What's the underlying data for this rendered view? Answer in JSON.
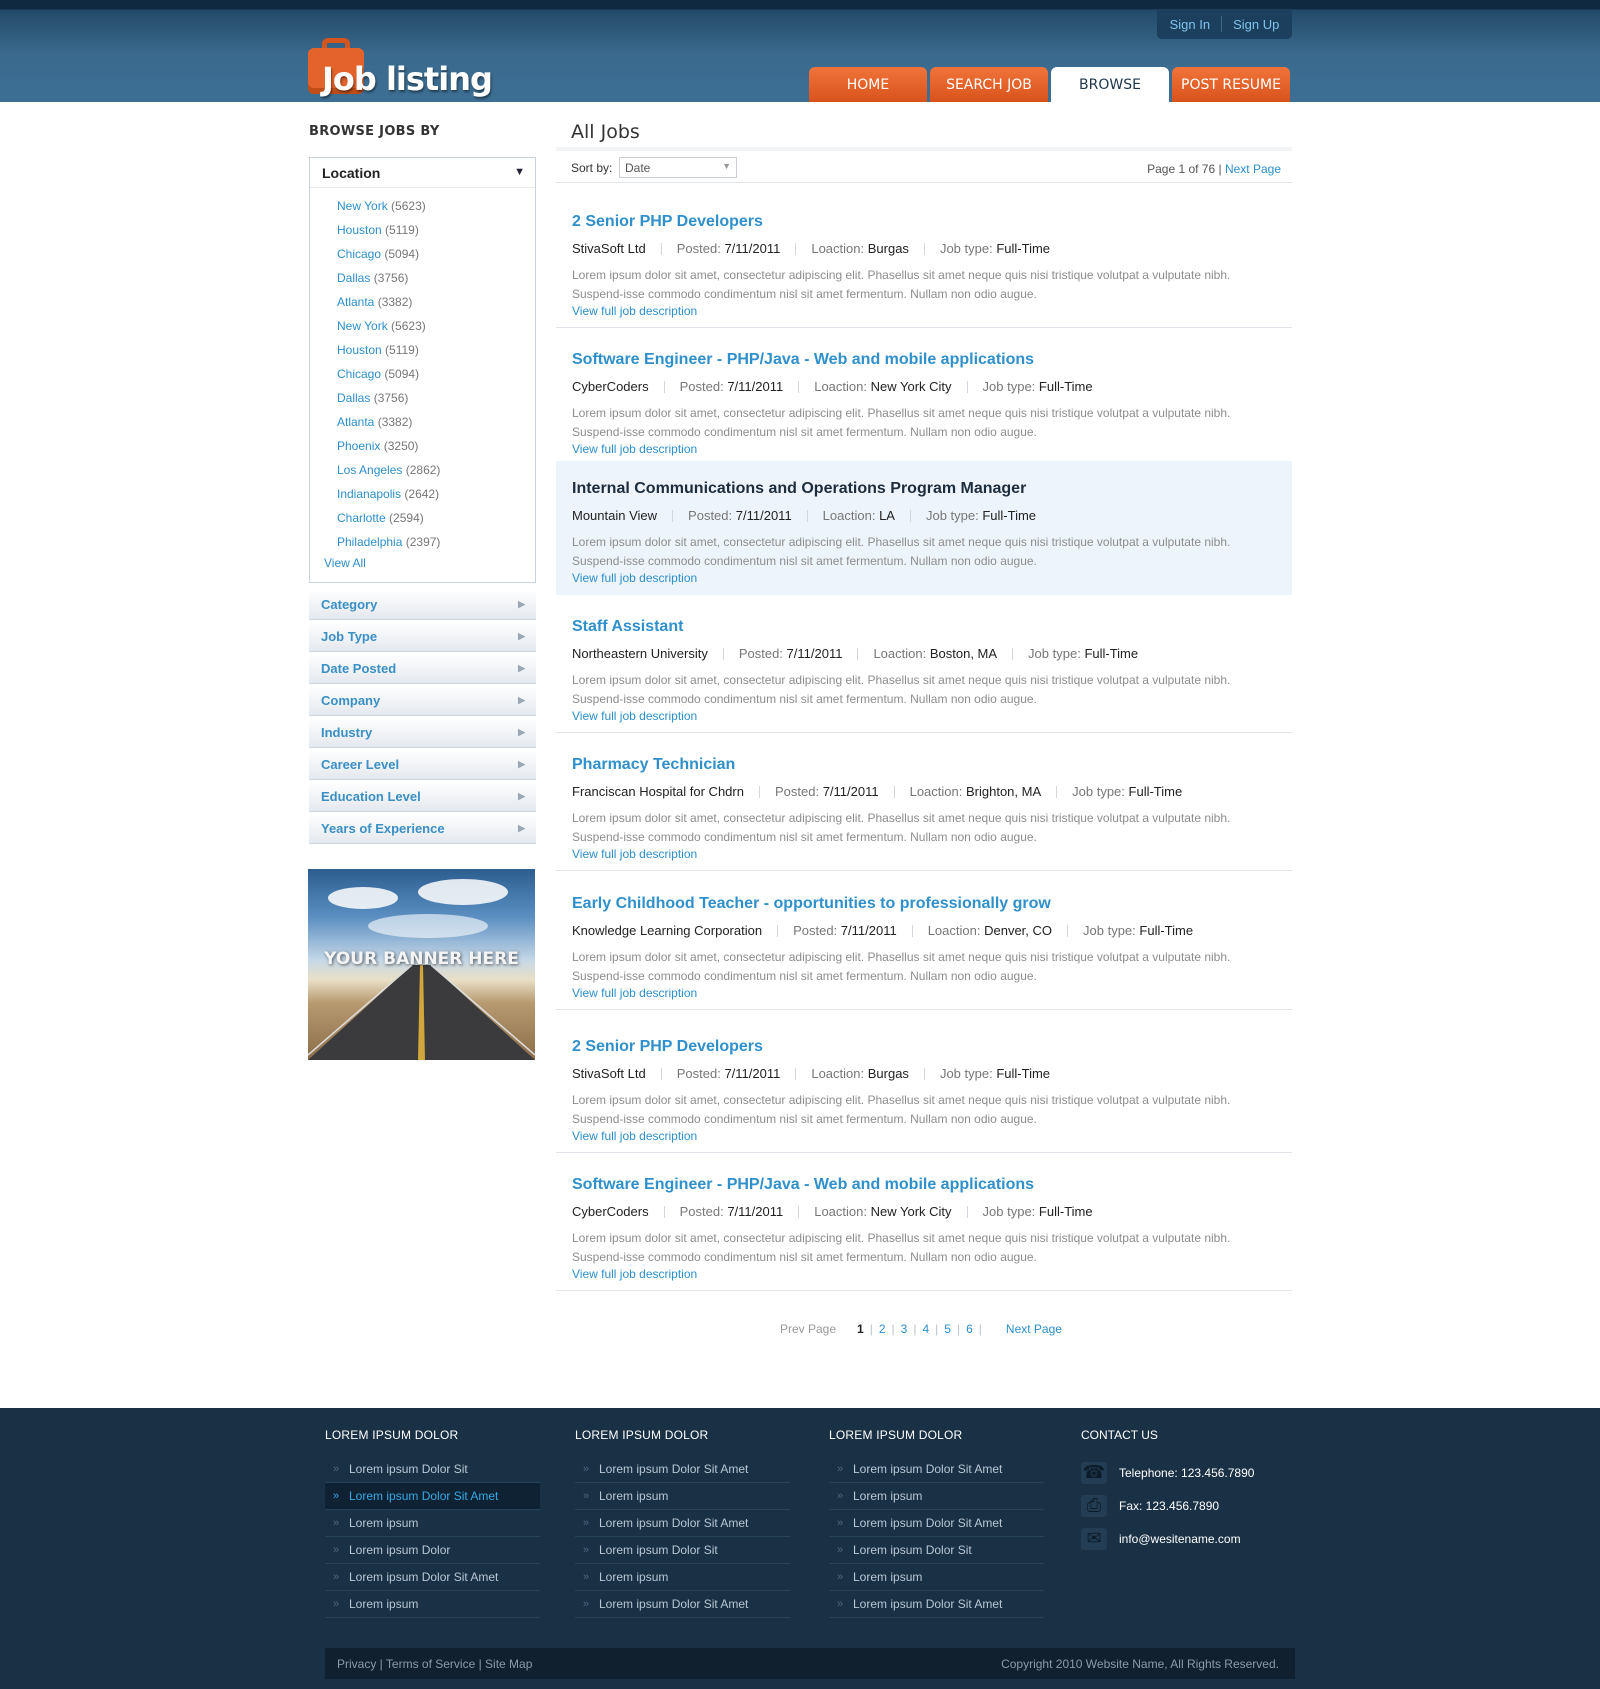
{
  "header": {
    "auth": {
      "sign_in": "Sign In",
      "sign_up": "Sign Up"
    },
    "logo": "Job listing",
    "nav": [
      {
        "label": "HOME",
        "active": false
      },
      {
        "label": "SEARCH JOB",
        "active": false
      },
      {
        "label": "BROWSE",
        "active": true
      },
      {
        "label": "POST RESUME",
        "active": false
      }
    ]
  },
  "sidebar": {
    "title": "BROWSE JOBS BY",
    "location": {
      "label": "Location",
      "items": [
        {
          "city": "New York",
          "count": "(5623)"
        },
        {
          "city": "Houston",
          "count": "(5119)"
        },
        {
          "city": "Chicago",
          "count": "(5094)"
        },
        {
          "city": "Dallas",
          "count": "(3756)"
        },
        {
          "city": "Atlanta",
          "count": "(3382)"
        },
        {
          "city": "New York",
          "count": "(5623)"
        },
        {
          "city": "Houston",
          "count": "(5119)"
        },
        {
          "city": "Chicago",
          "count": "(5094)"
        },
        {
          "city": "Dallas",
          "count": "(3756)"
        },
        {
          "city": "Atlanta",
          "count": "(3382)"
        },
        {
          "city": "Phoenix",
          "count": "(3250)"
        },
        {
          "city": "Los Angeles",
          "count": "(2862)"
        },
        {
          "city": "Indianapolis",
          "count": "(2642)"
        },
        {
          "city": "Charlotte",
          "count": "(2594)"
        },
        {
          "city": "Philadelphia",
          "count": "(2397)"
        }
      ],
      "view_all": "View All"
    },
    "filters": [
      "Category",
      "Job Type",
      "Date Posted",
      "Company",
      "Industry",
      "Career Level",
      "Education Level",
      "Years of Experience"
    ],
    "banner": "YOUR BANNER HERE"
  },
  "main": {
    "title": "All Jobs",
    "sort": {
      "label": "Sort by:",
      "value": "Date"
    },
    "page_info": "Page 1 of 76 |",
    "next_page": "Next Page",
    "jobs": [
      {
        "title": "2 Senior PHP Developers",
        "company": "StivaSoft Ltd",
        "posted_label": "Posted:",
        "posted": "7/11/2011",
        "location_label": "Loaction:",
        "location": "Burgas",
        "type_label": "Job type:",
        "type": "Full-Time",
        "desc": "Lorem ipsum dolor sit amet, consectetur adipiscing elit. Phasellus sit amet neque quis nisi tristique volutpat a vulputate nibh. Suspend-isse commodo condimentum nisl sit amet fermentum. Nullam non odio augue.",
        "more": "View full job description",
        "highlight": false
      },
      {
        "title": "Software Engineer - PHP/Java - Web and mobile applications",
        "company": "CyberCoders",
        "posted_label": "Posted:",
        "posted": "7/11/2011",
        "location_label": "Loaction:",
        "location": "New York City",
        "type_label": "Job type:",
        "type": "Full-Time",
        "desc": "Lorem ipsum dolor sit amet, consectetur adipiscing elit. Phasellus sit amet neque quis nisi tristique volutpat a vulputate nibh. Suspend-isse commodo condimentum nisl sit amet fermentum. Nullam non odio augue.",
        "more": "View full job description",
        "highlight": false
      },
      {
        "title": "Internal Communications and Operations Program Manager",
        "company": "Mountain View",
        "posted_label": "Posted:",
        "posted": "7/11/2011",
        "location_label": "Loaction:",
        "location": "LA",
        "type_label": "Job type:",
        "type": "Full-Time",
        "desc": "Lorem ipsum dolor sit amet, consectetur adipiscing elit. Phasellus sit amet neque quis nisi tristique volutpat a vulputate nibh. Suspend-isse commodo condimentum nisl sit amet fermentum. Nullam non odio augue.",
        "more": "View full job description",
        "highlight": true
      },
      {
        "title": "Staff Assistant",
        "company": "Northeastern University",
        "posted_label": "Posted:",
        "posted": "7/11/2011",
        "location_label": "Loaction:",
        "location": "Boston, MA",
        "type_label": "Job type:",
        "type": "Full-Time",
        "desc": "Lorem ipsum dolor sit amet, consectetur adipiscing elit. Phasellus sit amet neque quis nisi tristique volutpat a vulputate nibh. Suspend-isse commodo condimentum nisl sit amet fermentum. Nullam non odio augue.",
        "more": "View full job description",
        "highlight": false
      },
      {
        "title": "Pharmacy Technician",
        "company": "Franciscan Hospital for Chdrn",
        "posted_label": "Posted:",
        "posted": "7/11/2011",
        "location_label": "Loaction:",
        "location": "Brighton, MA",
        "type_label": "Job type:",
        "type": "Full-Time",
        "desc": "Lorem ipsum dolor sit amet, consectetur adipiscing elit. Phasellus sit amet neque quis nisi tristique volutpat a vulputate nibh. Suspend-isse commodo condimentum nisl sit amet fermentum. Nullam non odio augue.",
        "more": "View full job description",
        "highlight": false
      },
      {
        "title": "Early Childhood Teacher - opportunities to professionally grow",
        "company": "Knowledge Learning Corporation",
        "posted_label": "Posted:",
        "posted": "7/11/2011",
        "location_label": "Loaction:",
        "location": "Denver, CO",
        "type_label": "Job type:",
        "type": "Full-Time",
        "desc": "Lorem ipsum dolor sit amet, consectetur adipiscing elit. Phasellus sit amet neque quis nisi tristique volutpat a vulputate nibh. Suspend-isse commodo condimentum nisl sit amet fermentum. Nullam non odio augue.",
        "more": "View full job description",
        "highlight": false
      },
      {
        "title": "2 Senior PHP Developers",
        "company": "StivaSoft Ltd",
        "posted_label": "Posted:",
        "posted": "7/11/2011",
        "location_label": "Loaction:",
        "location": "Burgas",
        "type_label": "Job type:",
        "type": "Full-Time",
        "desc": "Lorem ipsum dolor sit amet, consectetur adipiscing elit. Phasellus sit amet neque quis nisi tristique volutpat a vulputate nibh. Suspend-isse commodo condimentum nisl sit amet fermentum. Nullam non odio augue.",
        "more": "View full job description",
        "highlight": false
      },
      {
        "title": "Software Engineer - PHP/Java - Web and mobile applications",
        "company": "CyberCoders",
        "posted_label": "Posted:",
        "posted": "7/11/2011",
        "location_label": "Loaction:",
        "location": "New York City",
        "type_label": "Job type:",
        "type": "Full-Time",
        "desc": "Lorem ipsum dolor sit amet, consectetur adipiscing elit. Phasellus sit amet neque quis nisi tristique volutpat a vulputate nibh. Suspend-isse commodo condimentum nisl sit amet fermentum. Nullam non odio augue.",
        "more": "View full job description",
        "highlight": false
      }
    ],
    "pager": {
      "prev": "Prev Page",
      "pages": [
        "1",
        "2",
        "3",
        "4",
        "5",
        "6"
      ],
      "current": "1",
      "next": "Next Page"
    }
  },
  "footer": {
    "columns": [
      {
        "title": "LOREM IPSUM DOLOR",
        "items": [
          "Lorem ipsum Dolor Sit",
          "Lorem ipsum Dolor Sit Amet",
          "Lorem ipsum",
          "Lorem ipsum Dolor",
          "Lorem ipsum Dolor Sit Amet",
          "Lorem ipsum"
        ],
        "active_index": 1
      },
      {
        "title": "LOREM IPSUM DOLOR",
        "items": [
          "Lorem ipsum Dolor Sit Amet",
          "Lorem ipsum",
          "Lorem ipsum Dolor Sit Amet",
          "Lorem ipsum Dolor Sit",
          "Lorem ipsum",
          "Lorem ipsum Dolor Sit Amet"
        ],
        "active_index": -1
      },
      {
        "title": "LOREM IPSUM DOLOR",
        "items": [
          "Lorem ipsum Dolor Sit Amet",
          "Lorem ipsum",
          "Lorem ipsum Dolor Sit Amet",
          "Lorem ipsum Dolor Sit",
          "Lorem ipsum",
          "Lorem ipsum Dolor Sit Amet"
        ],
        "active_index": -1
      }
    ],
    "contact": {
      "title": "CONTACT US",
      "telephone": "Telephone: 123.456.7890",
      "fax": "Fax: 123.456.7890",
      "email": "info@wesitename.com"
    },
    "links": "Privacy | Terms of Service | Site Map",
    "copyright": "Copyright 2010 Website Name, All Rights Reserved."
  }
}
